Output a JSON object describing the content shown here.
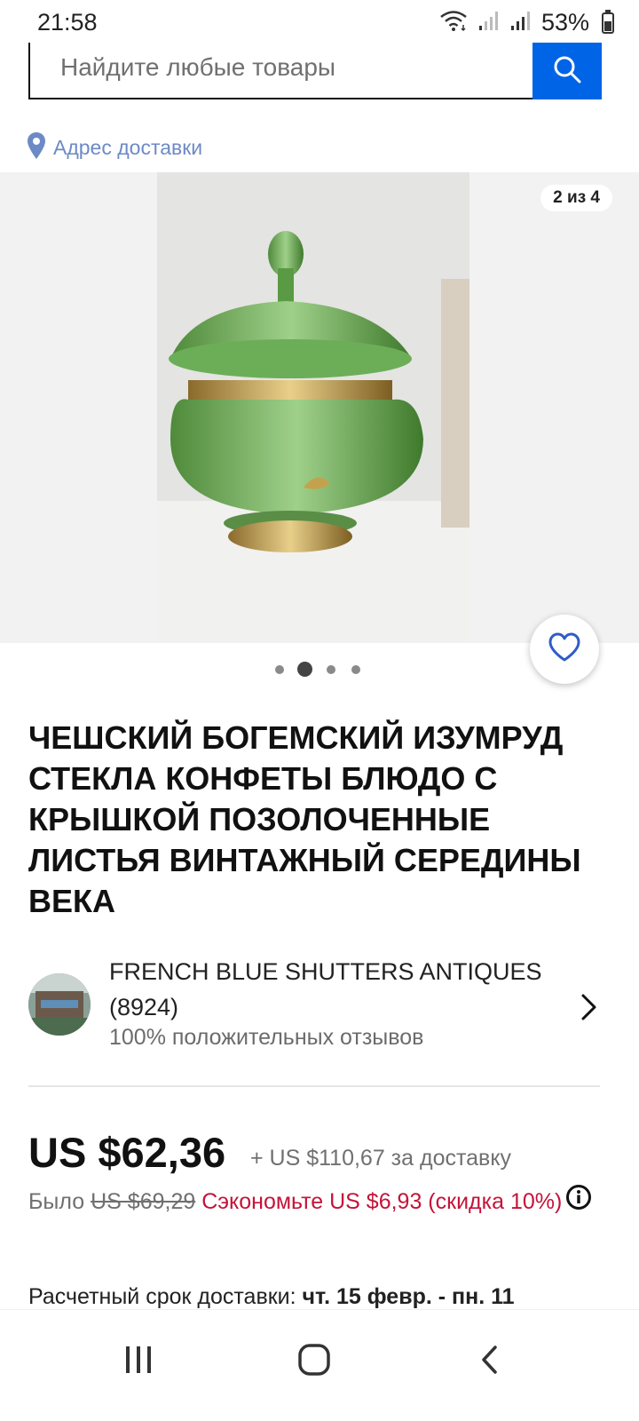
{
  "status_bar": {
    "time": "21:58",
    "battery": "53%"
  },
  "search": {
    "placeholder": "Найдите любые товары",
    "button_icon": "search-icon"
  },
  "delivery": {
    "label": "Адрес доставки",
    "icon": "location-pin-icon"
  },
  "gallery": {
    "counter": "2 из 4",
    "current_index": 2,
    "total": 4
  },
  "favorite": {
    "icon": "heart-icon"
  },
  "listing": {
    "title": "ЧЕШСКИЙ БОГЕМСКИЙ ИЗУМРУД СТЕКЛА КОНФЕТЫ БЛЮДО С КРЫШКОЙ ПОЗОЛОЧЕННЫЕ ЛИСТЬЯ ВИНТАЖНЫЙ СЕРЕДИНЫ ВЕКА"
  },
  "seller": {
    "name": "FRENCH BLUE SHUTTERS ANTIQUES",
    "feedback_count": "(8924)",
    "rating_text": "100% положительных отзывов"
  },
  "pricing": {
    "price": "US $62,36",
    "shipping": "+ US $110,67 за доставку",
    "was_label": "Было",
    "old_price": "US $69,29",
    "save_text": "Сэкономьте US $6,93 (скидка 10%)"
  },
  "delivery_estimate": {
    "label": "Расчетный срок доставки:",
    "dates": "чт. 15 февр. - пн. 11"
  },
  "colors": {
    "accent": "#0064e6",
    "discount": "#c4133a",
    "link": "#6d8ac6"
  },
  "nav_bar": {
    "recents_icon": "recent-apps-icon",
    "home_icon": "home-icon",
    "back_icon": "back-icon"
  }
}
